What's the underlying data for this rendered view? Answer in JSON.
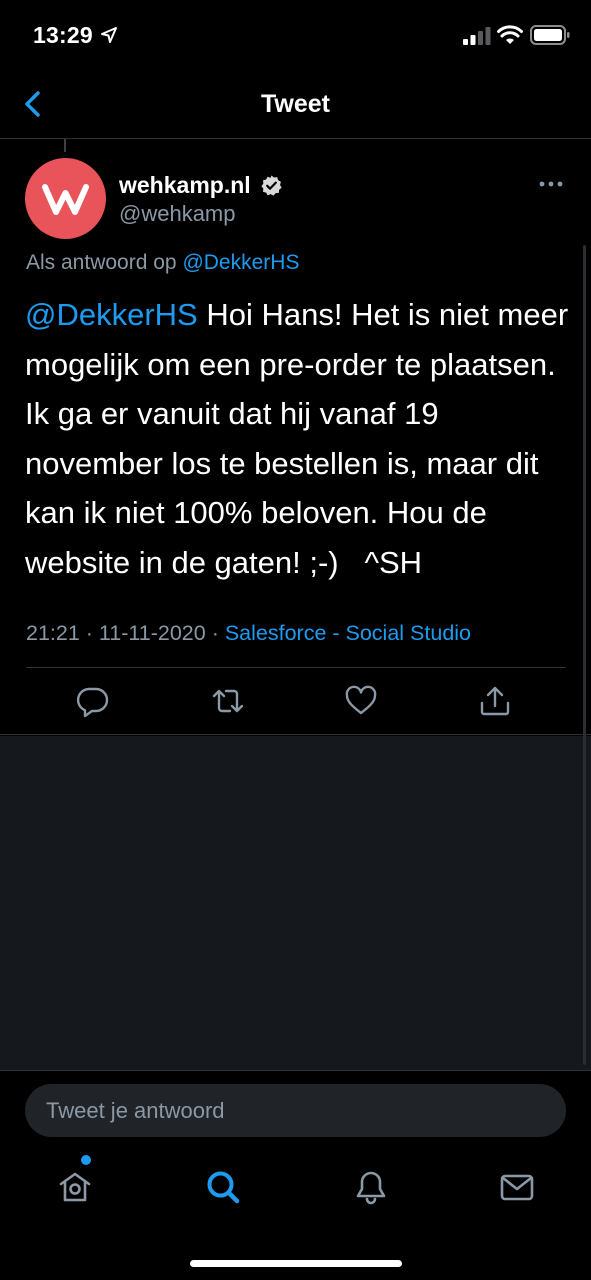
{
  "status_bar": {
    "time": "13:29",
    "location_icon": "location-arrow-icon",
    "signal_icon": "cellular-signal-icon",
    "wifi_icon": "wifi-icon",
    "battery_icon": "battery-icon"
  },
  "nav": {
    "title": "Tweet",
    "back_icon": "chevron-left-icon"
  },
  "tweet": {
    "author": {
      "name": "wehkamp.nl",
      "handle": "@wehkamp",
      "verified": true,
      "avatar_letter": "W",
      "avatar_color": "#e8545a"
    },
    "reply_context": {
      "prefix": "Als antwoord op ",
      "mention": "@DekkerHS"
    },
    "text": {
      "mention": "@DekkerHS",
      "body": " Hoi Hans! Het is niet meer mogelijk om een pre-order te plaatsen. Ik ga er vanuit dat hij vanaf 19 november los te bestellen is, maar dit kan ik niet 100% beloven. Hou de website in de gaten! ;-)   ^SH"
    },
    "meta": {
      "time": "21:21",
      "separator": " · ",
      "date": "11-11-2020",
      "source": "Salesforce - Social Studio"
    },
    "actions": [
      "reply-icon",
      "retweet-icon",
      "like-icon",
      "share-icon"
    ]
  },
  "composer": {
    "placeholder": "Tweet je antwoord"
  },
  "tabs": [
    "home-icon",
    "search-icon",
    "notifications-icon",
    "messages-icon"
  ],
  "colors": {
    "background": "#000000",
    "accent": "#1d9bf0",
    "secondary_text": "#8b98a5",
    "divider": "#2f3336",
    "empty_area": "#15181c"
  }
}
